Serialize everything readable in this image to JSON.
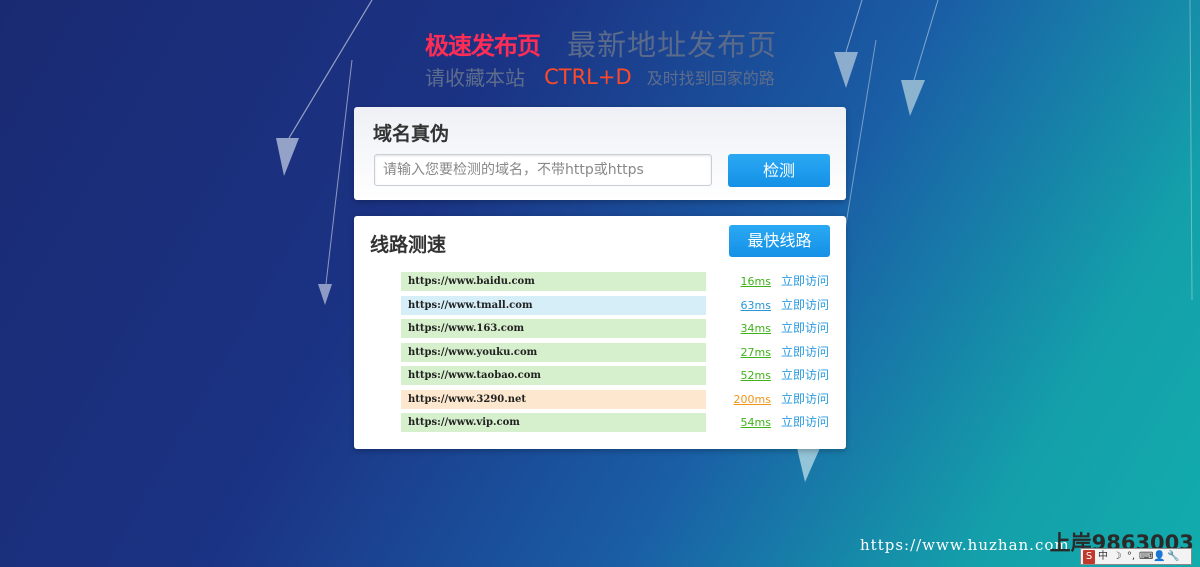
{
  "hero": {
    "badge": "极速发布页",
    "title": "最新地址发布页",
    "subtitle_pre": "请收藏本站",
    "subtitle_key": "CTRL+D",
    "subtitle_post": "及时找到回家的路"
  },
  "verify": {
    "title": "域名真伪",
    "placeholder": "请输入您要检测的域名，不带http或https",
    "button_label": "检测"
  },
  "speed": {
    "title": "线路测速",
    "button_label": "最快线路",
    "visit_label": "立即访问",
    "lines": [
      {
        "url": "https://www.baidu.com",
        "ms": "16ms",
        "bg": "#d6efcc",
        "ms_color": "#3fb21a"
      },
      {
        "url": "https://www.tmall.com",
        "ms": "63ms",
        "bg": "#d6eef8",
        "ms_color": "#2a95d6"
      },
      {
        "url": "https://www.163.com",
        "ms": "34ms",
        "bg": "#d6efcc",
        "ms_color": "#3fb21a"
      },
      {
        "url": "https://www.youku.com",
        "ms": "27ms",
        "bg": "#d6efcc",
        "ms_color": "#3fb21a"
      },
      {
        "url": "https://www.taobao.com",
        "ms": "52ms",
        "bg": "#d6efcc",
        "ms_color": "#3fb21a"
      },
      {
        "url": "https://www.3290.net",
        "ms": "200ms",
        "bg": "#fde8cf",
        "ms_color": "#f0941a"
      },
      {
        "url": "https://www.vip.com",
        "ms": "54ms",
        "bg": "#d6efcc",
        "ms_color": "#3fb21a"
      }
    ]
  },
  "watermark": {
    "url": "https://www.huzhan.com",
    "id": "上岸9863003"
  },
  "ime": {
    "items": [
      "中",
      "☽",
      "°,",
      "⌨",
      "👤",
      "🔧"
    ]
  }
}
